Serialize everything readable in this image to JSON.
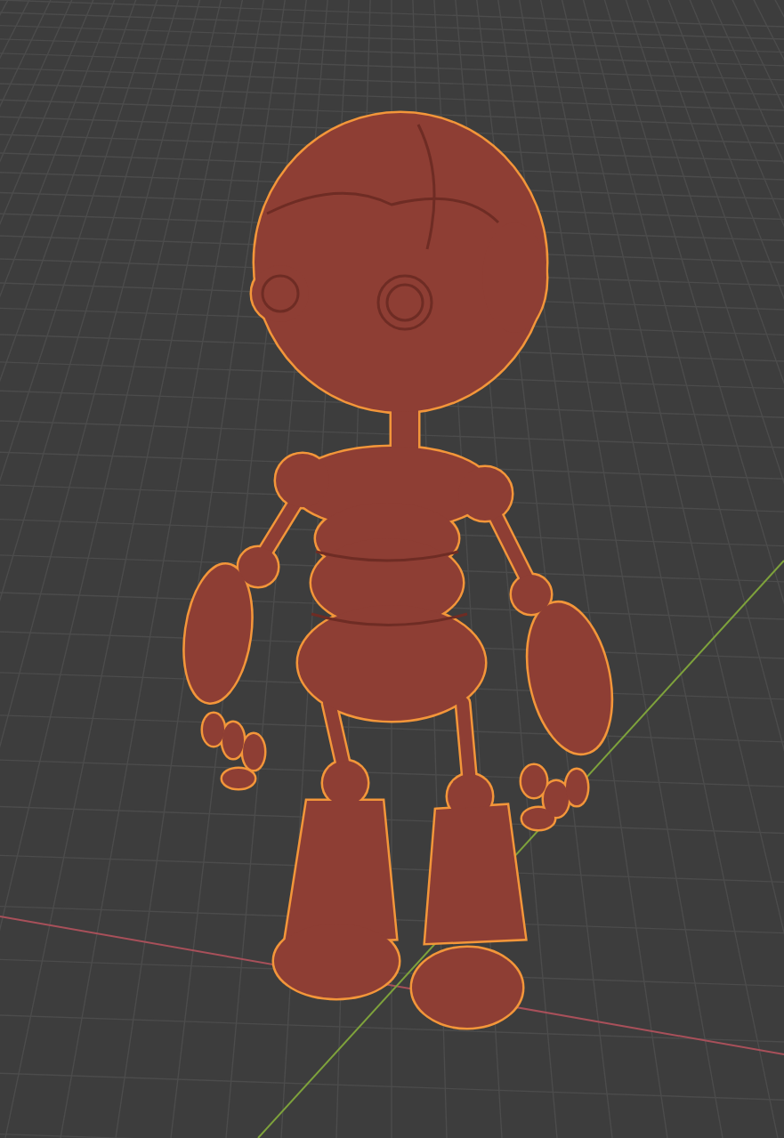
{
  "viewport": {
    "axes": [
      {
        "kind": "x",
        "color": "#a8505a"
      },
      {
        "kind": "y",
        "color": "#7ea23c"
      }
    ],
    "model": {
      "selected": true
    }
  }
}
